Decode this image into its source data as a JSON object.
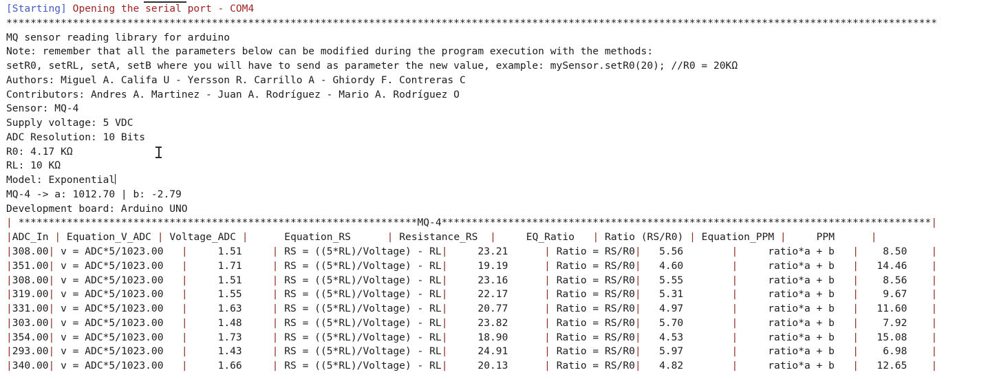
{
  "window": {
    "app": "serial-monitor",
    "background_color": "#ffffff",
    "text_color": "#1c1c1c",
    "accent_blue": "#4259c4",
    "accent_red": "#9e2222",
    "pipe_color": "#8c2b22"
  },
  "status_line": {
    "tag": "[Starting]",
    "message": " Opening the serial port - COM4"
  },
  "separator_top": "**********************************************************************************************************************************************************",
  "header_lines": [
    "MQ sensor reading library for arduino",
    "Note: remember that all the parameters below can be modified during the program execution with the methods:",
    "setR0, setRL, setA, setB where you will have to send as parameter the new value, example: mySensor.setR0(20); //R0 = 20KΩ",
    "Authors: Miguel A. Califa U - Yersson R. Carrillo A - Ghiordy F. Contreras C",
    "Contributors: Andres A. Martinez - Juan A. Rodríguez - Mario A. Rodríguez O",
    "Sensor: MQ-4",
    "Supply voltage: 5 VDC",
    "ADC Resolution: 10 Bits",
    "R0: 4.17 KΩ",
    "RL: 10 KΩ"
  ],
  "model_line": "Model: Exponential",
  "coefficients_line": "MQ-4 -> a: 1012.70 | b: -2.79",
  "board_line": "Development board: Arduino UNO",
  "table": {
    "banner_left": "| ",
    "banner_stars_left": "******************************************************************",
    "banner_title": "MQ-4",
    "banner_stars_right": "*********************************************************************************",
    "banner_right": "|",
    "header_row": "|ADC_In | Equation_V_ADC | Voltage_ADC |      Equation_RS      | Resistance_RS  |     EQ_Ratio   | Ratio (RS/R0) | Equation_PPM |     PPM      |",
    "columns": [
      "ADC_In",
      "Equation_V_ADC",
      "Voltage_ADC",
      "Equation_RS",
      "Resistance_RS",
      "EQ_Ratio",
      "Ratio (RS/R0)",
      "Equation_PPM",
      "PPM"
    ],
    "rows": [
      {
        "adc_in": "308.00",
        "equation_v_adc": "v = ADC*5/1023.00",
        "voltage_adc": "1.51",
        "equation_rs": "RS = ((5*RL)/Voltage) - RL",
        "resistance_rs": "23.21",
        "eq_ratio": "Ratio = RS/R0",
        "ratio": "5.56",
        "equation_ppm": "ratio*a + b",
        "ppm": "8.50"
      },
      {
        "adc_in": "351.00",
        "equation_v_adc": "v = ADC*5/1023.00",
        "voltage_adc": "1.71",
        "equation_rs": "RS = ((5*RL)/Voltage) - RL",
        "resistance_rs": "19.19",
        "eq_ratio": "Ratio = RS/R0",
        "ratio": "4.60",
        "equation_ppm": "ratio*a + b",
        "ppm": "14.46"
      },
      {
        "adc_in": "308.00",
        "equation_v_adc": "v = ADC*5/1023.00",
        "voltage_adc": "1.51",
        "equation_rs": "RS = ((5*RL)/Voltage) - RL",
        "resistance_rs": "23.16",
        "eq_ratio": "Ratio = RS/R0",
        "ratio": "5.55",
        "equation_ppm": "ratio*a + b",
        "ppm": "8.56"
      },
      {
        "adc_in": "319.00",
        "equation_v_adc": "v = ADC*5/1023.00",
        "voltage_adc": "1.55",
        "equation_rs": "RS = ((5*RL)/Voltage) - RL",
        "resistance_rs": "22.17",
        "eq_ratio": "Ratio = RS/R0",
        "ratio": "5.31",
        "equation_ppm": "ratio*a + b",
        "ppm": "9.67"
      },
      {
        "adc_in": "331.00",
        "equation_v_adc": "v = ADC*5/1023.00",
        "voltage_adc": "1.63",
        "equation_rs": "RS = ((5*RL)/Voltage) - RL",
        "resistance_rs": "20.77",
        "eq_ratio": "Ratio = RS/R0",
        "ratio": "4.97",
        "equation_ppm": "ratio*a + b",
        "ppm": "11.60"
      },
      {
        "adc_in": "303.00",
        "equation_v_adc": "v = ADC*5/1023.00",
        "voltage_adc": "1.48",
        "equation_rs": "RS = ((5*RL)/Voltage) - RL",
        "resistance_rs": "23.82",
        "eq_ratio": "Ratio = RS/R0",
        "ratio": "5.70",
        "equation_ppm": "ratio*a + b",
        "ppm": "7.92"
      },
      {
        "adc_in": "354.00",
        "equation_v_adc": "v = ADC*5/1023.00",
        "voltage_adc": "1.73",
        "equation_rs": "RS = ((5*RL)/Voltage) - RL",
        "resistance_rs": "18.90",
        "eq_ratio": "Ratio = RS/R0",
        "ratio": "4.53",
        "equation_ppm": "ratio*a + b",
        "ppm": "15.08"
      },
      {
        "adc_in": "293.00",
        "equation_v_adc": "v = ADC*5/1023.00",
        "voltage_adc": "1.43",
        "equation_rs": "RS = ((5*RL)/Voltage) - RL",
        "resistance_rs": "24.91",
        "eq_ratio": "Ratio = RS/R0",
        "ratio": "5.97",
        "equation_ppm": "ratio*a + b",
        "ppm": "6.98"
      },
      {
        "adc_in": "340.00",
        "equation_v_adc": "v = ADC*5/1023.00",
        "voltage_adc": "1.66",
        "equation_rs": "RS = ((5*RL)/Voltage) - RL",
        "resistance_rs": "20.13",
        "eq_ratio": "Ratio = RS/R0",
        "ratio": "4.82",
        "equation_ppm": "ratio*a + b",
        "ppm": "12.65"
      }
    ]
  }
}
